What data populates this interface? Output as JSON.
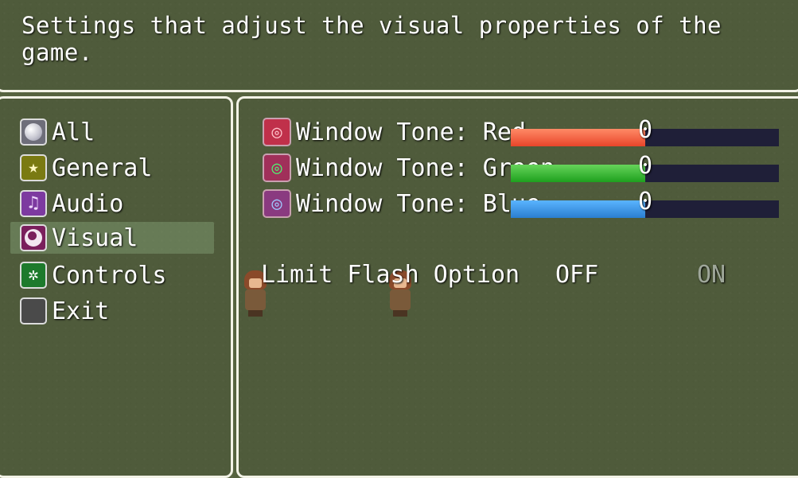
{
  "help": {
    "text": "Settings that adjust the visual properties of the game."
  },
  "commands": [
    {
      "label": "All",
      "icon": "orb-icon"
    },
    {
      "label": "General",
      "icon": "star-icon"
    },
    {
      "label": "Audio",
      "icon": "harp-icon"
    },
    {
      "label": "Visual",
      "icon": "eye-icon",
      "selected": true
    },
    {
      "label": "Controls",
      "icon": "gear-icon"
    },
    {
      "label": "Exit",
      "icon": "blank-icon"
    }
  ],
  "options": {
    "tones": [
      {
        "label": "Window Tone: Red",
        "value": "0",
        "level": 0.5,
        "color": "#e8452a"
      },
      {
        "label": "Window Tone: Green",
        "value": "0",
        "level": 0.5,
        "color": "#1ea01e"
      },
      {
        "label": "Window Tone: Blue",
        "value": "0",
        "level": 0.5,
        "color": "#2a7ed0"
      }
    ],
    "flash": {
      "label": "Limit Flash Option",
      "off": "OFF",
      "on": "ON",
      "selected": "OFF"
    }
  }
}
